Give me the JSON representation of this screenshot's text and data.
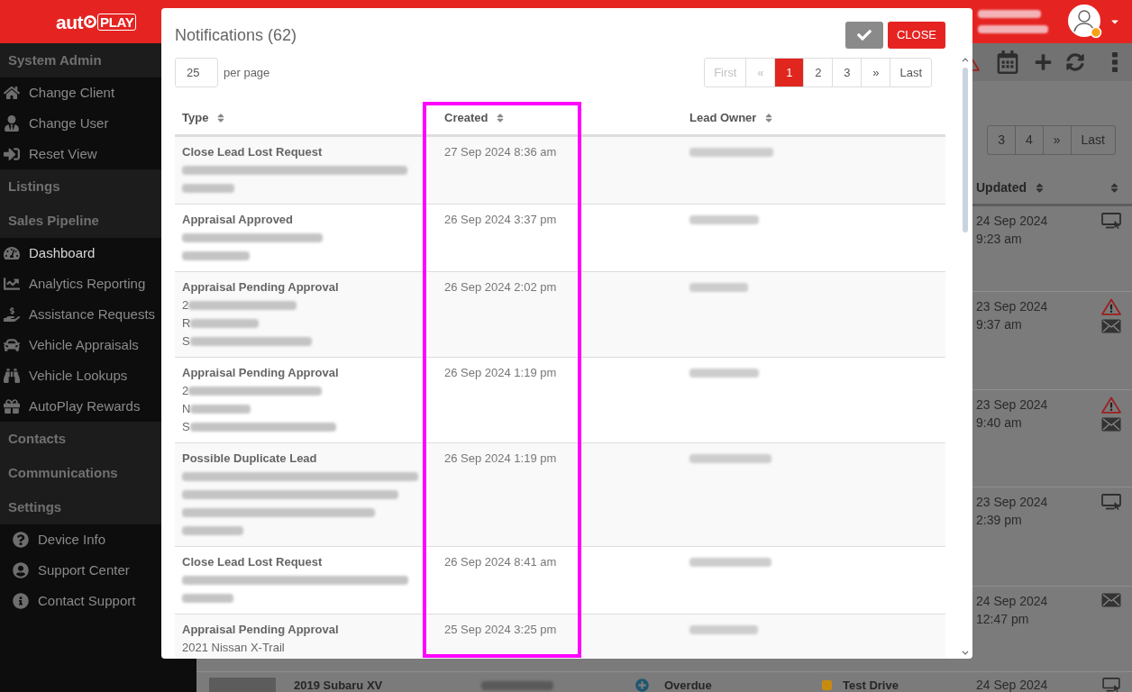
{
  "header": {
    "logo": {
      "text": "aut",
      "boxed_text": "PLAY"
    },
    "user_info": [
      {
        "kind": "redacted"
      },
      {
        "kind": "redacted"
      }
    ]
  },
  "sidebar": {
    "sections": [
      {
        "title": "System Admin",
        "items": [
          {
            "label": "Change Client",
            "selected": false
          },
          {
            "label": "Change User",
            "selected": false
          },
          {
            "label": "Reset View",
            "selected": false
          }
        ]
      },
      {
        "title": "Listings"
      },
      {
        "title": "Sales Pipeline",
        "items": [
          {
            "label": "Dashboard",
            "selected": true
          },
          {
            "label": "Analytics Reporting",
            "selected": false
          },
          {
            "label": "Assistance Requests",
            "selected": false
          },
          {
            "label": "Vehicle Appraisals",
            "selected": false
          },
          {
            "label": "Vehicle Lookups",
            "selected": false
          },
          {
            "label": "AutoPlay Rewards",
            "selected": false
          }
        ]
      },
      {
        "title": "Contacts"
      },
      {
        "title": "Communications"
      },
      {
        "title": "Settings",
        "items": [
          {
            "label": "Device Info",
            "selected": false
          },
          {
            "label": "Support Center",
            "selected": false
          },
          {
            "label": "Contact Support",
            "selected": false
          }
        ]
      }
    ]
  },
  "listings": {
    "pagination": [
      {
        "label": "3",
        "selected": false
      },
      {
        "label": "4",
        "selected": false
      },
      {
        "label": "»",
        "selected": false
      },
      {
        "label": "Last",
        "selected": false
      }
    ],
    "updated_column": "Updated",
    "rows": [
      {
        "updated_date": "24 Sep 2024",
        "updated_time": "9:23 am",
        "icons": [
          {
            "kind": "screen"
          }
        ]
      },
      {
        "updated_date": "23 Sep 2024",
        "updated_time": "9:37 am",
        "icons": [
          {
            "kind": "warning"
          },
          {
            "kind": "mail"
          }
        ]
      },
      {
        "updated_date": "23 Sep 2024",
        "updated_time": "9:40 am",
        "icons": [
          {
            "kind": "warning"
          },
          {
            "kind": "mail"
          }
        ]
      },
      {
        "updated_date": "23 Sep 2024",
        "updated_time": "2:39 pm",
        "icons": [
          {
            "kind": "screen"
          }
        ]
      },
      {
        "updated_date": "24 Sep 2024",
        "updated_time": "12:47 pm",
        "icons": [
          {
            "kind": "mail"
          }
        ]
      },
      {
        "vehicle": "2019 Subaru XV",
        "owner": {
          "kind": "redacted"
        },
        "status": "Overdue",
        "type": {
          "label": "Test Drive",
          "color": "#c98a10"
        },
        "updated_date": "24 Sep 2024",
        "icons": [
          {
            "kind": "screen"
          }
        ]
      }
    ]
  },
  "modal": {
    "title": "Notifications (62)",
    "close_button": "CLOSE",
    "per_page": {
      "value": "25",
      "label": "per page"
    },
    "pagination": [
      {
        "label": "First",
        "disabled": true,
        "selected": false
      },
      {
        "label": "«",
        "disabled": true,
        "selected": false
      },
      {
        "label": "1",
        "disabled": false,
        "selected": true
      },
      {
        "label": "2",
        "disabled": false,
        "selected": false
      },
      {
        "label": "3",
        "disabled": false,
        "selected": false
      },
      {
        "label": "»",
        "disabled": false,
        "selected": false
      },
      {
        "label": "Last",
        "disabled": false,
        "selected": false
      }
    ],
    "columns": [
      "Type",
      "Created",
      "Lead Owner"
    ],
    "annotation": {
      "kind": "frame"
    },
    "rows": [
      {
        "type": "Close Lead Lost Request",
        "details": [
          {
            "kind": "redacted"
          },
          {
            "kind": "redacted"
          }
        ],
        "created": "27 Sep 2024 8:36 am",
        "lead_owner": {
          "kind": "redacted"
        }
      },
      {
        "type": "Appraisal Approved",
        "details": [
          {
            "kind": "redacted"
          },
          {
            "kind": "redacted"
          }
        ],
        "created": "26 Sep 2024 3:37 pm",
        "lead_owner": {
          "kind": "redacted"
        }
      },
      {
        "type": "Appraisal Pending Approval",
        "details": [
          {
            "kind": "redacted",
            "prefix": "2"
          },
          {
            "kind": "redacted",
            "prefix": "R"
          },
          {
            "kind": "redacted",
            "prefix": "S"
          }
        ],
        "created": "26 Sep 2024 2:02 pm",
        "lead_owner": {
          "kind": "redacted"
        }
      },
      {
        "type": "Appraisal Pending Approval",
        "details": [
          {
            "kind": "redacted",
            "prefix": "2"
          },
          {
            "kind": "redacted",
            "prefix": "N"
          },
          {
            "kind": "redacted",
            "prefix": "S"
          }
        ],
        "created": "26 Sep 2024 1:19 pm",
        "lead_owner": {
          "kind": "redacted"
        }
      },
      {
        "type": "Possible Duplicate Lead",
        "details": [
          {
            "kind": "redacted"
          },
          {
            "kind": "redacted"
          },
          {
            "kind": "redacted"
          },
          {
            "kind": "redacted"
          }
        ],
        "created": "26 Sep 2024 1:19 pm",
        "lead_owner": {
          "kind": "redacted"
        }
      },
      {
        "type": "Close Lead Lost Request",
        "details": [
          {
            "kind": "redacted"
          },
          {
            "kind": "redacted"
          }
        ],
        "created": "26 Sep 2024 8:41 am",
        "lead_owner": {
          "kind": "redacted"
        }
      },
      {
        "type": "Appraisal Pending Approval",
        "details": [
          {
            "kind": "text",
            "text": "2021 Nissan X-Trail"
          }
        ],
        "created": "25 Sep 2024 3:25 pm",
        "lead_owner": {
          "kind": "redacted"
        }
      }
    ]
  }
}
